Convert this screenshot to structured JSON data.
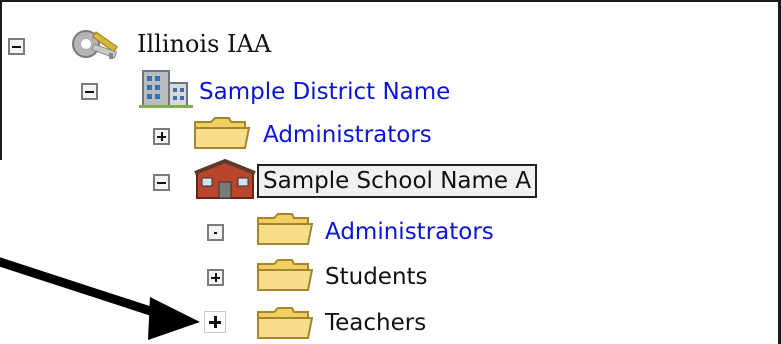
{
  "tree": {
    "root": {
      "label": "Illinois IAA",
      "icon": "keys-icon",
      "toggle": "collapse"
    },
    "district": {
      "label": "Sample District Name",
      "icon": "building-icon",
      "toggle": "collapse"
    },
    "district_admins": {
      "label": "Administrators",
      "icon": "folder-icon",
      "toggle": "expand"
    },
    "school": {
      "label": "Sample School Name A",
      "icon": "school-icon",
      "toggle": "collapse",
      "selected": true
    },
    "school_admins": {
      "label": "Administrators",
      "icon": "folder-icon",
      "toggle": "leaf"
    },
    "students": {
      "label": "Students",
      "icon": "folder-icon",
      "toggle": "expand"
    },
    "teachers": {
      "label": "Teachers",
      "icon": "folder-icon",
      "toggle": "expand"
    }
  },
  "colors": {
    "link": "#0a14d6",
    "text": "#111111",
    "folder": "#f2cf63",
    "arrow": "#000000"
  }
}
